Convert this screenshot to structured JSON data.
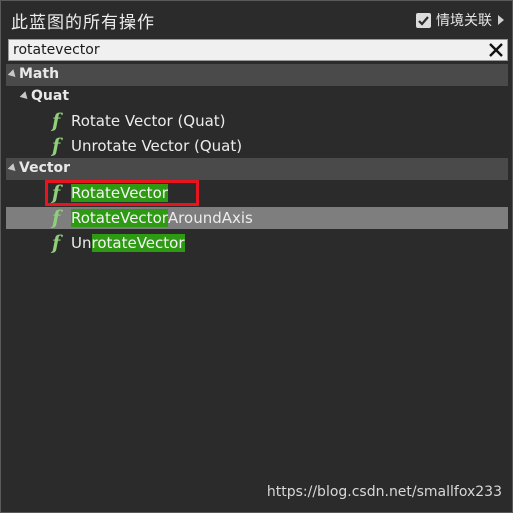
{
  "header": {
    "title": "此蓝图的所有操作",
    "context_label": "情境关联",
    "context_checked": true
  },
  "search": {
    "value": "rotatevector"
  },
  "tree": {
    "math": {
      "label": "Math",
      "quat": {
        "label": "Quat",
        "items": [
          {
            "label": "Rotate Vector (Quat)"
          },
          {
            "label": "Unrotate Vector (Quat)"
          }
        ]
      }
    },
    "vector": {
      "label": "Vector",
      "items": [
        {
          "pre": "",
          "match": "RotateVector",
          "post": ""
        },
        {
          "pre": "",
          "match": "RotateVector",
          "post": "AroundAxis"
        },
        {
          "pre": "Un",
          "match": "rotateVector",
          "post": ""
        }
      ]
    }
  },
  "icon_glyph": "f",
  "watermark": "https://blog.csdn.net/smallfox233",
  "colors": {
    "background": "#2b2b2b",
    "category_bar": "#4a4a4a",
    "selected_row": "#7e7e7e",
    "match_highlight": "#2e9a14",
    "function_icon": "#8fd07a",
    "annotation_box": "#e8141e"
  }
}
